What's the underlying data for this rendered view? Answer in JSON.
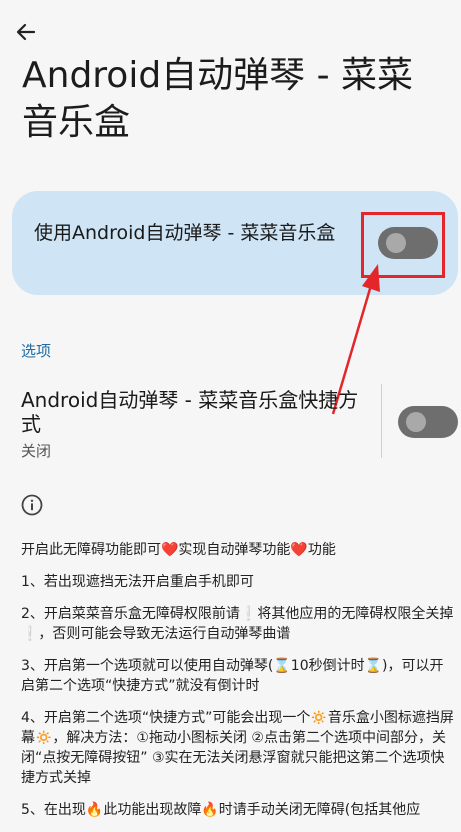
{
  "header": {
    "back_icon": "arrow-left-icon",
    "title": "Android自动弹琴 - 菜菜音乐盒"
  },
  "main_switch": {
    "label": "使用Android自动弹琴 - 菜菜音乐盒",
    "state": "off"
  },
  "options": {
    "section_label": "选项",
    "shortcut_title": "Android自动弹琴 - 菜菜音乐盒快捷方式",
    "shortcut_status": "关闭",
    "shortcut_state": "off"
  },
  "info_icon": "info-icon",
  "description": {
    "p0": "开启此无障碍功能即可❤️实现自动弹琴功能❤️功能",
    "p1": "1、若出现遮挡无法开启重启手机即可",
    "p2": "2、开启菜菜音乐盒无障碍权限前请❕将其他应用的无障碍权限全关掉❕，否则可能会导致无法运行自动弹琴曲谱",
    "p3": "3、开启第一个选项就可以使用自动弹琴(⌛10秒倒计时⌛)，可以开启第二个选项“快捷方式”就没有倒计时",
    "p4": "4、开启第二个选项“快捷方式”可能会出现一个🔅音乐盒小图标遮挡屏幕🔅，解决方法：①拖动小图标关闭 ②点击第二个选项中间部分，关闭“点按无障碍按钮” ③实在无法关闭悬浮窗就只能把这第二个选项快捷方式关掉",
    "p5": "5、在出现🔥此功能出现故障🔥时请手动关闭无障碍(包括其他应"
  },
  "colors": {
    "card_bg": "#cfe4f4",
    "accent": "#1f6ba3",
    "annotation_red": "#e3262a",
    "toggle_off": "#6e6e6e"
  }
}
